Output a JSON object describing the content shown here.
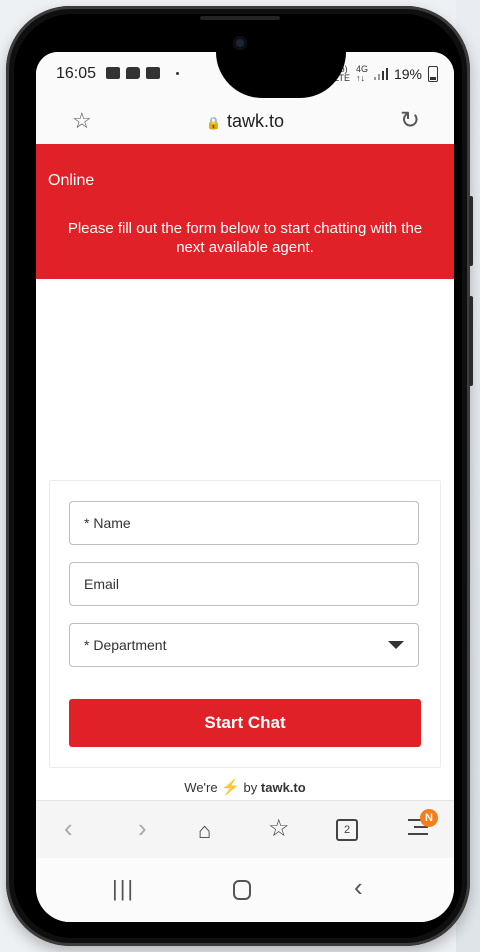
{
  "status_bar": {
    "time": "16:05",
    "network": "Vo) 4G\nLTE",
    "battery": "19%"
  },
  "browser": {
    "url": "tawk.to",
    "tabs_count": "2",
    "menu_badge": "N"
  },
  "chat": {
    "status": "Online",
    "message": "Please fill out the form below to start chatting with the next available agent.",
    "header_color": "#e02127"
  },
  "form": {
    "name_placeholder": "* Name",
    "email_placeholder": "Email",
    "department_placeholder": "* Department",
    "submit_label": "Start Chat"
  },
  "powered": {
    "prefix": "We're",
    "suffix": "by",
    "brand": "tawk.to"
  }
}
